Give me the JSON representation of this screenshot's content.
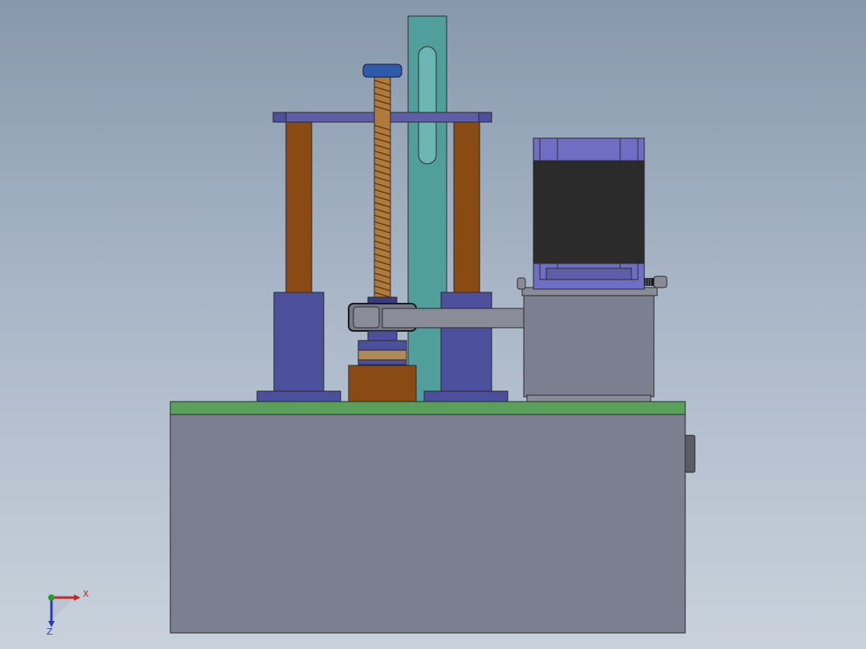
{
  "colors": {
    "background_top": "#8898ac",
    "background_bottom": "#c9d2dc",
    "housing_gray": "#7b7f90",
    "base_plate_green": "#5aa05a",
    "bracket_teal": "#519f9c",
    "column_copper": "#8a4a14",
    "support_navy": "#4c4f9c",
    "motor_black": "#2b2b2b",
    "motor_purple": "#6e6ec4",
    "axis_x": "#c0282a",
    "axis_y": "#2a9a2a",
    "axis_z": "#2a3ac0"
  },
  "triad": {
    "x_label": "X",
    "z_label": "Z"
  }
}
